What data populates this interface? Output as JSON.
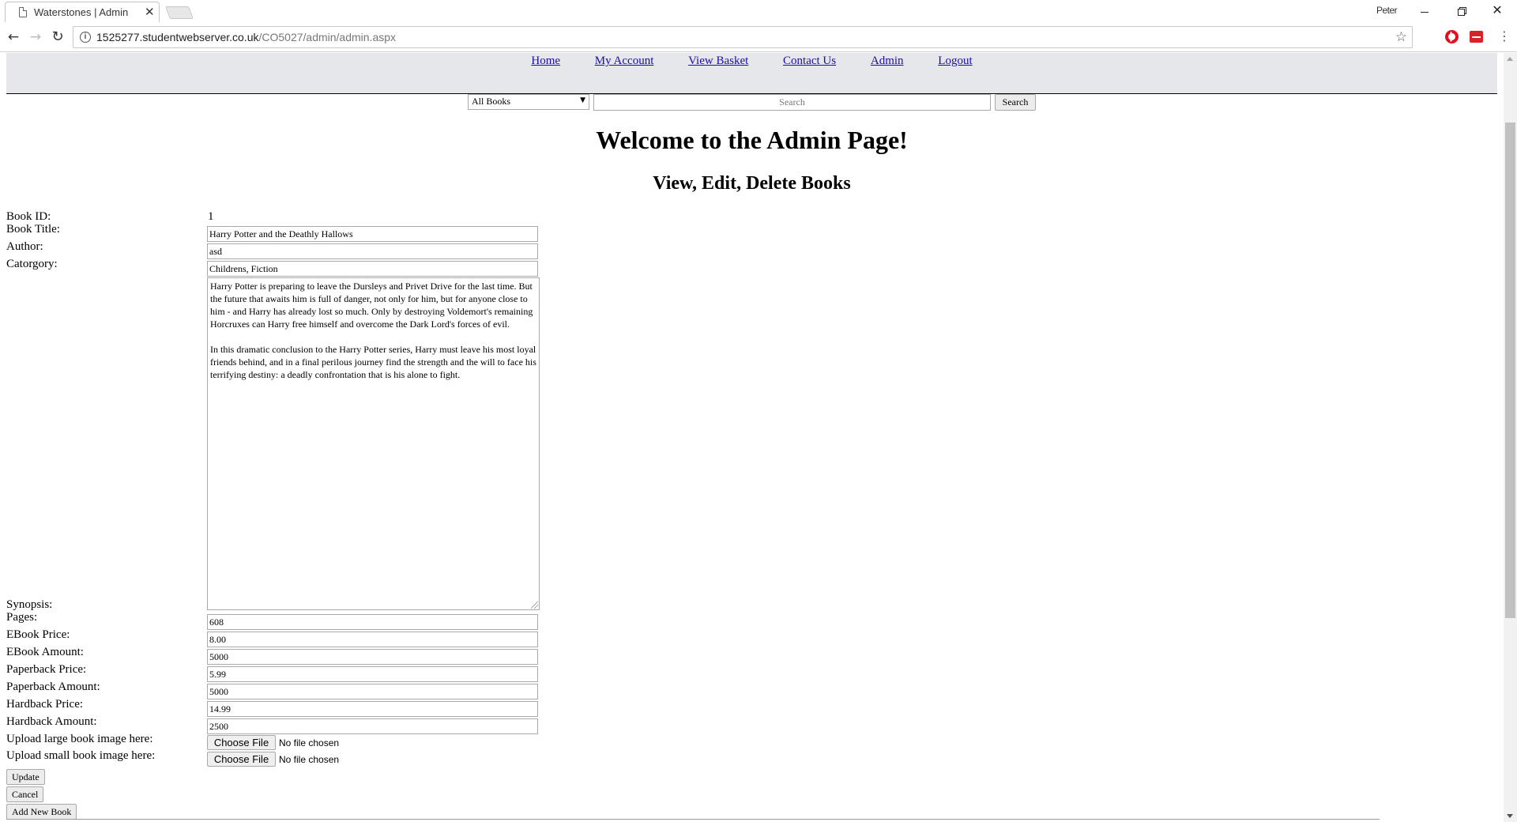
{
  "browser": {
    "tab_title": "Waterstones | Admin",
    "tab_close": "✕",
    "profile_name": "Peter",
    "url_domain": "1525277.studentwebserver.co.uk",
    "url_path": "/CO5027/admin/admin.aspx"
  },
  "site": {
    "nav": [
      {
        "label": "Home"
      },
      {
        "label": "My Account"
      },
      {
        "label": "View Basket"
      },
      {
        "label": "Contact Us"
      },
      {
        "label": "Admin"
      },
      {
        "label": "Logout"
      }
    ],
    "search": {
      "category_selected": "All Books",
      "placeholder": "Search",
      "button_label": "Search"
    }
  },
  "page": {
    "heading": "Welcome to the Admin Page!",
    "subheading": "View, Edit, Delete Books"
  },
  "form": {
    "labels": {
      "book_id": "Book ID:",
      "book_title": "Book Title:",
      "author": "Author:",
      "category": "Catorgory:",
      "synopsis": "Synopsis:",
      "pages": "Pages:",
      "ebook_price": "EBook Price:",
      "ebook_amount": "EBook Amount:",
      "paperback_price": "Paperback Price:",
      "paperback_amount": "Paperback Amount:",
      "hardback_price": "Hardback Price:",
      "hardback_amount": "Hardback Amount:",
      "upload_large": "Upload large book image here:",
      "upload_small": "Upload small book image here:"
    },
    "values": {
      "book_id": "1",
      "book_title": "Harry Potter and the Deathly Hallows",
      "author": "asd",
      "category": "Childrens, Fiction",
      "synopsis_p1": "Harry Potter is preparing to leave the Dursleys and Privet Drive for the last time. But the future that awaits him is full of danger, not only for him, but for anyone close to him - and Harry has already lost so much. Only by destroying Voldemort's remaining Horcruxes can Harry free himself and overcome the Dark Lord's forces of evil.",
      "synopsis_p2": "In this dramatic conclusion to the Harry Potter series, Harry must leave his most loyal friends behind, and in a final perilous journey find the strength and the will to face his terrifying destiny: a deadly confrontation that is his alone to fight.",
      "pages": "608",
      "ebook_price": "8.00",
      "ebook_amount": "5000",
      "paperback_price": "5.99",
      "paperback_amount": "5000",
      "hardback_price": "14.99",
      "hardback_amount": "2500"
    },
    "file_button": "Choose File",
    "no_file": "No file chosen",
    "buttons": {
      "update": "Update",
      "cancel": "Cancel",
      "add_new": "Add New Book"
    }
  }
}
